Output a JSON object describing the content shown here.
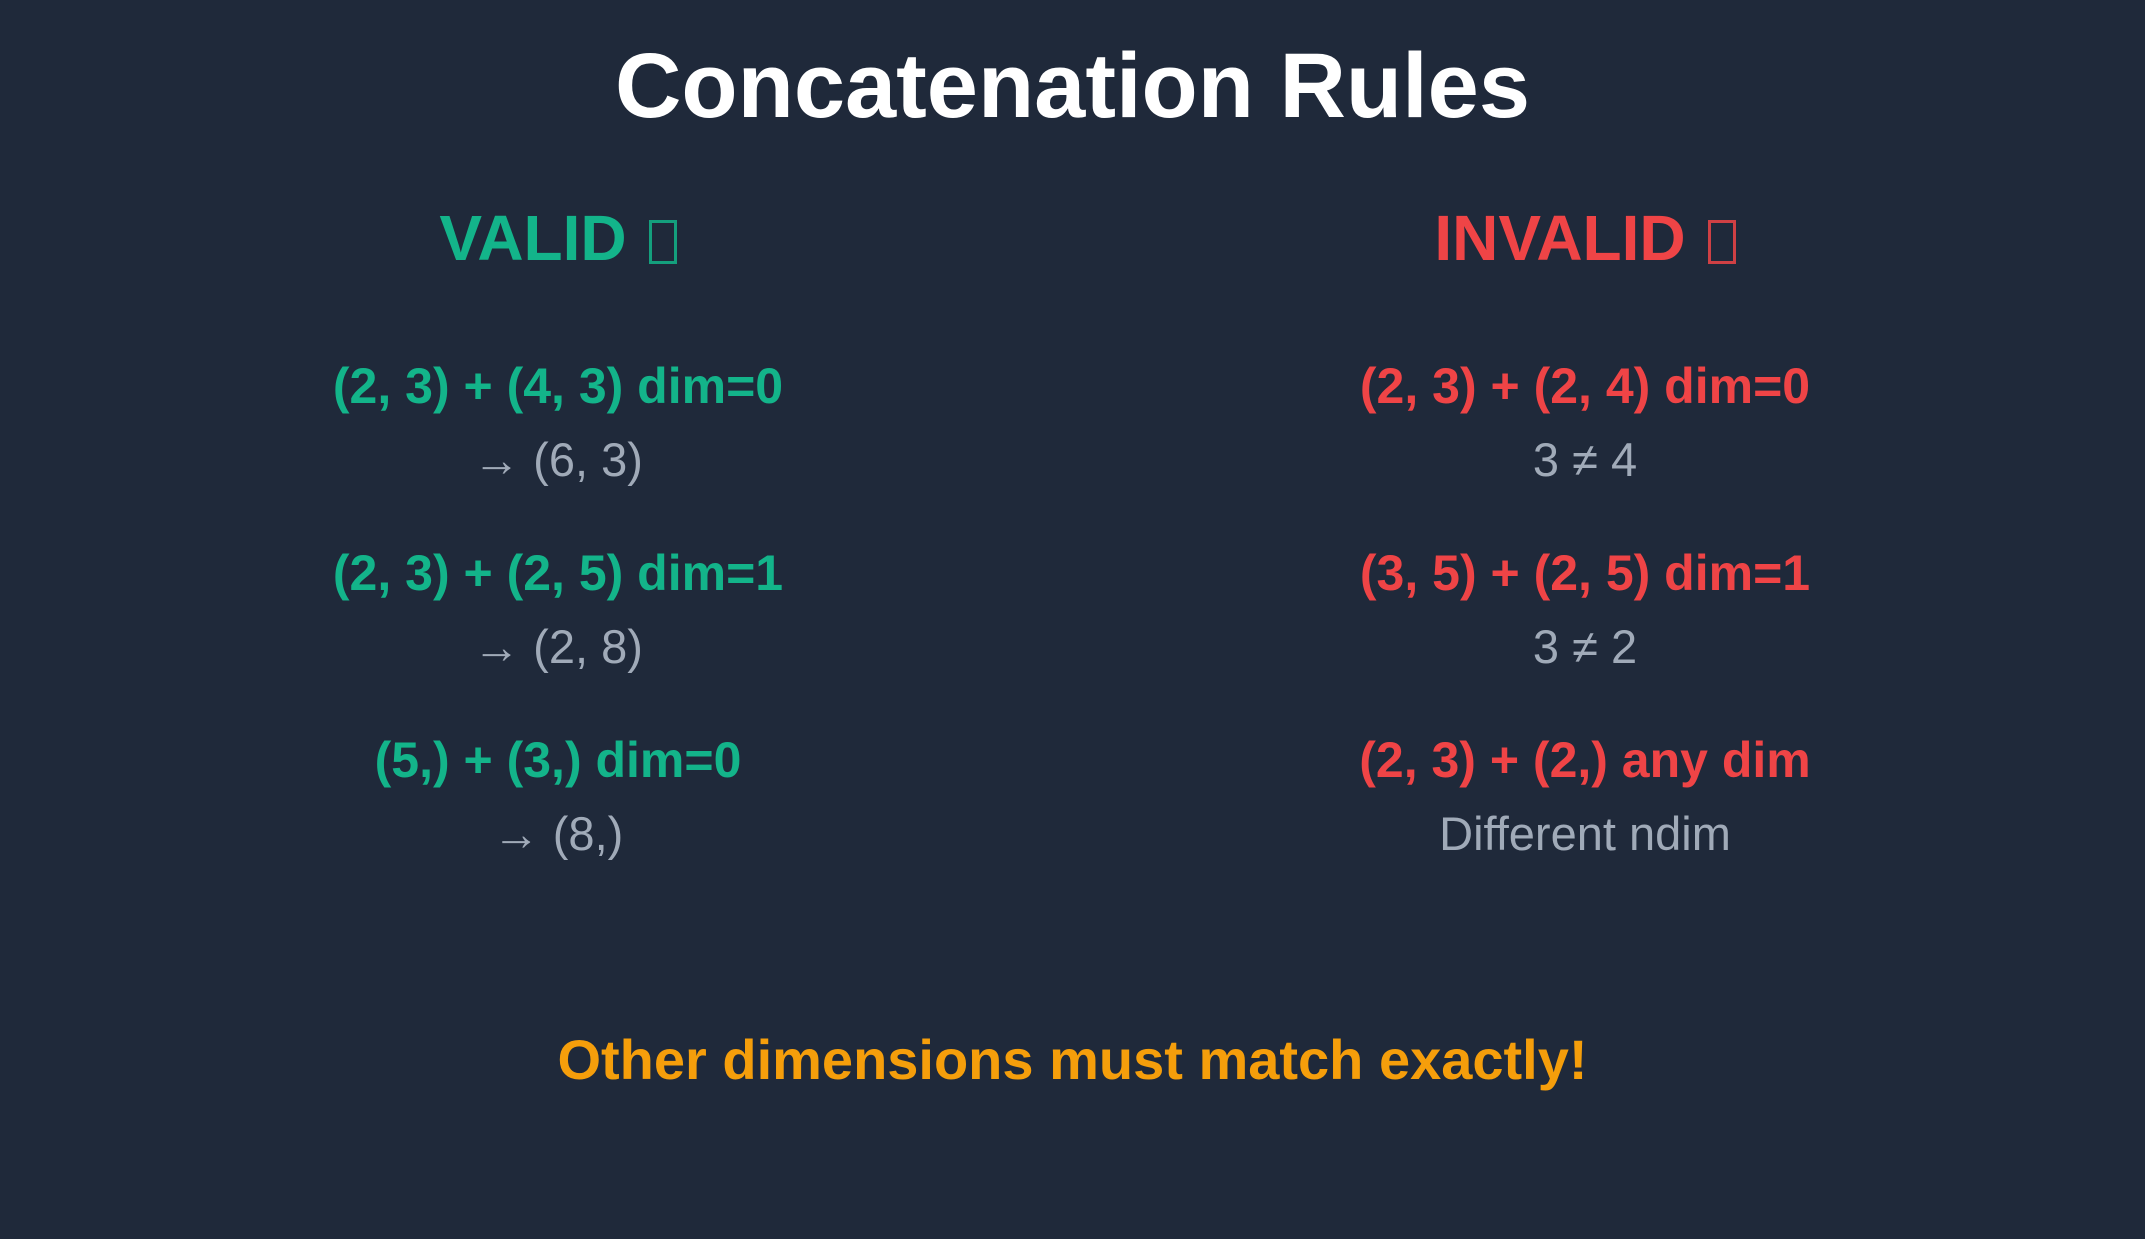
{
  "title": "Concatenation Rules",
  "valid": {
    "heading": "VALID",
    "color": "#13b48a",
    "items": [
      {
        "expr": "(2, 3) + (4, 3) dim=0",
        "result": "→ (6, 3)"
      },
      {
        "expr": "(2, 3) + (2, 5) dim=1",
        "result": "→ (2, 8)"
      },
      {
        "expr": "(5,) + (3,) dim=0",
        "result": "→ (8,)"
      }
    ]
  },
  "invalid": {
    "heading": "INVALID",
    "color": "#ef4446",
    "items": [
      {
        "expr": "(2, 3) + (2, 4) dim=0",
        "result": "3 ≠ 4"
      },
      {
        "expr": "(3, 5) + (2, 5) dim=1",
        "result": "3 ≠ 2"
      },
      {
        "expr": "(2, 3) + (2,) any dim",
        "result": "Different ndim"
      }
    ]
  },
  "footer": "Other dimensions must match exactly!",
  "colors": {
    "background": "#1f293a",
    "title": "#ffffff",
    "result_text": "#a0aab8",
    "footer": "#f59e0b"
  }
}
